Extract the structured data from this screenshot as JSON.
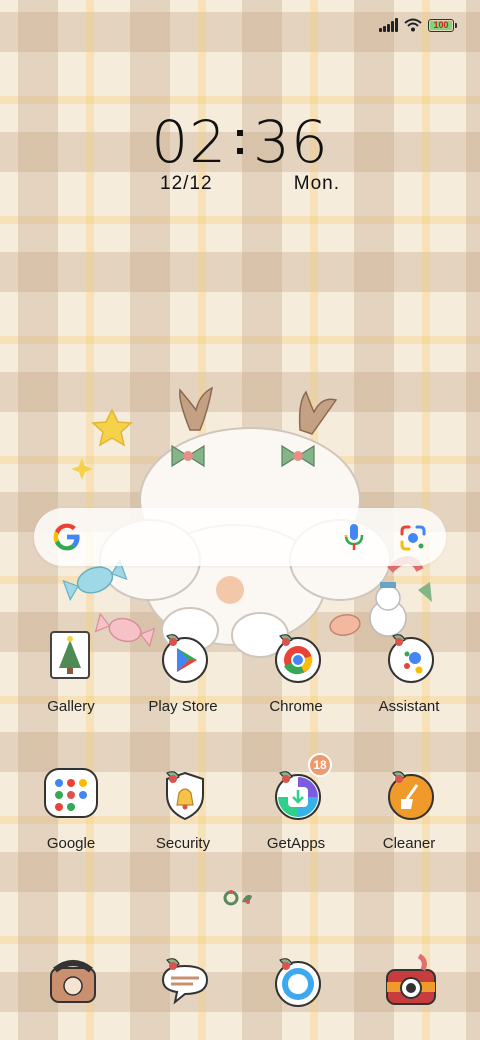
{
  "status_bar": {
    "battery_level": "100"
  },
  "clock": {
    "time_hours": "02",
    "time_minutes": "36",
    "date": "12/12",
    "weekday": "Mon."
  },
  "search_widget": {
    "icons": [
      "google-g-icon",
      "microphone-icon",
      "google-lens-icon"
    ]
  },
  "apps_row1": [
    {
      "label": "Gallery"
    },
    {
      "label": "Play Store"
    },
    {
      "label": "Chrome"
    },
    {
      "label": "Assistant"
    }
  ],
  "apps_row2": [
    {
      "label": "Google"
    },
    {
      "label": "Security"
    },
    {
      "label": "GetApps",
      "badge": "18"
    },
    {
      "label": "Cleaner"
    }
  ],
  "dock_icons": [
    "phone-icon",
    "messages-icon",
    "browser-icon",
    "camera-icon"
  ],
  "colors": {
    "background": "#f6ecdc",
    "badge": "#ef9a6c",
    "text": "#222222"
  }
}
